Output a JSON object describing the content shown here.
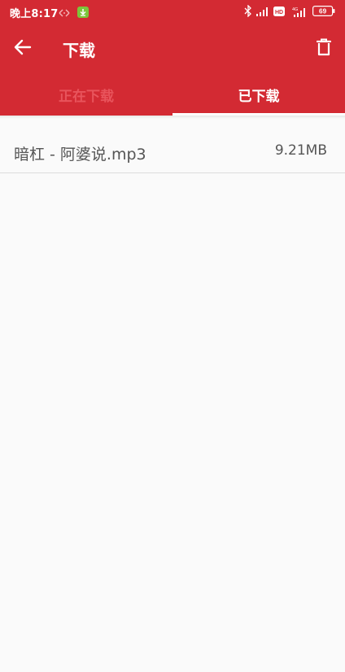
{
  "status_bar": {
    "time": "晚上8:17",
    "battery": "69",
    "network": "4G",
    "colors": {
      "background": "#d32a33",
      "text": "#ffffff"
    },
    "icons": [
      "sync-icon",
      "download-notification-icon",
      "bluetooth-icon",
      "signal-icon",
      "hd-icon",
      "signal-4g-icon",
      "battery-icon"
    ]
  },
  "toolbar": {
    "title": "下载",
    "back_icon": "arrow-left-icon",
    "delete_icon": "trash-icon"
  },
  "tabs": [
    {
      "label": "正在下载",
      "active": false
    },
    {
      "label": "已下载",
      "active": true
    }
  ],
  "downloads": [
    {
      "name": "暗杠 - 阿婆说.mp3",
      "size": "9.21MB"
    }
  ],
  "theme": {
    "primary": "#d32a33",
    "inactive_tab": "#e8545c",
    "background": "#fafafa",
    "text": "#555555"
  }
}
